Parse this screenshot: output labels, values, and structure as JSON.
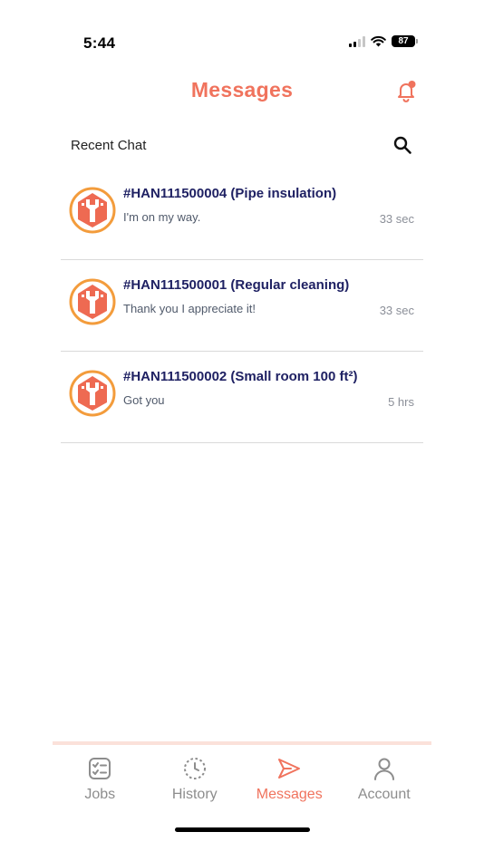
{
  "status_bar": {
    "time": "5:44",
    "battery": "87"
  },
  "header": {
    "title": "Messages"
  },
  "recent": {
    "label": "Recent Chat"
  },
  "chats": [
    {
      "title": "#HAN111500004 (Pipe insulation)",
      "preview": "I'm on my way.",
      "time": "33 sec"
    },
    {
      "title": "#HAN111500001 (Regular cleaning)",
      "preview": "Thank you I appreciate it!",
      "time": "33 sec"
    },
    {
      "title": "#HAN111500002 (Small room 100 ft²)",
      "preview": "Got you",
      "time": "5 hrs"
    }
  ],
  "tabs": [
    {
      "label": "Jobs",
      "icon": "jobs-checklist-icon",
      "active": false
    },
    {
      "label": "History",
      "icon": "history-clock-icon",
      "active": false
    },
    {
      "label": "Messages",
      "icon": "send-icon",
      "active": true
    },
    {
      "label": "Account",
      "icon": "person-icon",
      "active": false
    }
  ],
  "colors": {
    "accent": "#f0735d",
    "title_text": "#1f2163",
    "inactive_tab": "#8d8d8d",
    "avatar_ring": "#f39c3c"
  }
}
